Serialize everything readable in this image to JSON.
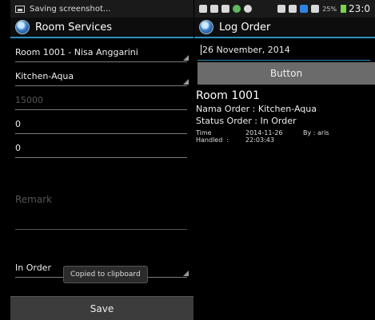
{
  "left_screen": {
    "status_bar": {
      "notification": "Saving screenshot..."
    },
    "action_bar": {
      "title": "Room Services"
    },
    "fields": {
      "room": "Room 1001 - Nisa Anggarini",
      "item": "Kitchen-Aqua",
      "price_hint": "15000",
      "quantity": "0",
      "total": "0",
      "remark_hint": "Remark",
      "status": "In Order"
    },
    "toast": "Copied to clipboard",
    "save_label": "Save"
  },
  "right_screen": {
    "status_bar": {
      "signal_text": "25%",
      "time": "23:0"
    },
    "action_bar": {
      "title": "Log Order"
    },
    "date_value": "26 November, 2014",
    "button_label": "Button",
    "room": "Room 1001",
    "order_name": "Nama Order : Kitchen-Aqua",
    "order_status": "Status Order : In Order",
    "time_handled_label": "Time Handled",
    "time_handled_sep": ":",
    "time_handled_value": "2014-11-26 22:03:43",
    "handled_by": "By : aris"
  }
}
